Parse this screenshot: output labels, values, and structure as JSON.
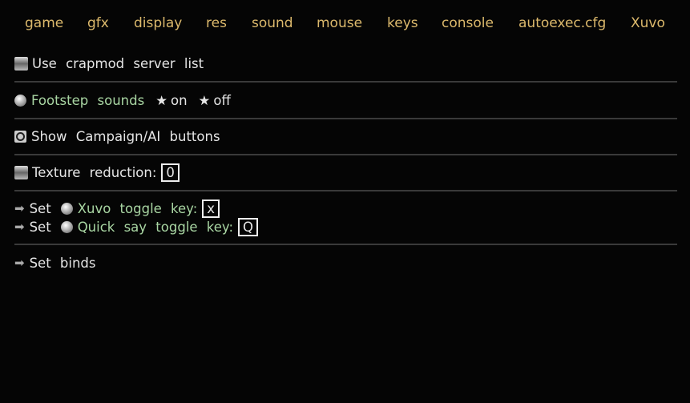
{
  "tabs": [
    "game",
    "gfx",
    "display",
    "res",
    "sound",
    "mouse",
    "keys",
    "console",
    "autoexec.cfg",
    "Xuvo"
  ],
  "options": {
    "crapmod": "Use crapmod server list",
    "footstep": {
      "label": "Footstep sounds",
      "on": "on",
      "off": "off"
    },
    "campaign": "Show Campaign/AI buttons",
    "texture": {
      "label": "Texture reduction:",
      "value": "0"
    },
    "xuvo": {
      "set": "Set",
      "label": "Xuvo toggle key:",
      "value": "x"
    },
    "quicksay": {
      "set": "Set",
      "label": "Quick say toggle key:",
      "value": "Q"
    },
    "binds": "Set binds"
  },
  "colors": {
    "tab": "#dcb96c",
    "highlight": "#a9d6a3"
  }
}
